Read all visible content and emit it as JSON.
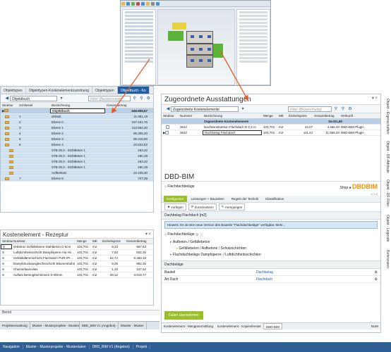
{
  "left_panel": {
    "tabs": [
      "Objekttypen",
      "Objekttypen-Kostenelementzuordnung",
      "Objekttypen",
      "Objektbuch - Ko"
    ],
    "combo": "Objektbuch",
    "filter_placeholder": "Filter (Bezeichnung)",
    "columns": [
      "Struktur",
      "Schlüssel",
      "Bezeichnung",
      "Gesamtbetrag"
    ],
    "rows": [
      {
        "key": "",
        "name": "Objektbuch",
        "amount": "546.855,67"
      },
      {
        "key": "1",
        "name": "default",
        "amount": "11.081,19"
      },
      {
        "key": "2",
        "name": "Ebene 0",
        "amount": "187.161,76"
      },
      {
        "key": "3",
        "name": "Ebene 1",
        "amount": "112.552,20"
      },
      {
        "key": "4",
        "name": "Ebene 2",
        "amount": "95.306,20"
      },
      {
        "key": "5",
        "name": "Ebene 3",
        "amount": "95.218,60"
      },
      {
        "key": "6",
        "name": "Ebene 4",
        "amount": "22.632,52"
      },
      {
        "key": "",
        "name": "STB 30.0 - Sichtbeton 1",
        "amount": "183,42"
      },
      {
        "key": "",
        "name": "STB 30.0 - Sichtbeton 1",
        "amount": "180,19"
      },
      {
        "key": "",
        "name": "STB 30.0 - Sichtbeton 1",
        "amount": "183,42"
      },
      {
        "key": "",
        "name": "STB 30.0 - Sichtbeton 1",
        "amount": "180,19"
      },
      {
        "key": "",
        "name": "Aufbetsatz",
        "amount": "22.105,30"
      },
      {
        "key": "7",
        "name": "Ebene 5",
        "amount": "727,39"
      }
    ]
  },
  "rezept": {
    "title": "Kostenelement - Rezeptur",
    "columns": [
      "Struktur",
      "Nutztext",
      "Menge",
      "ME",
      "Einheitspreis",
      "Gesamtbetrag"
    ],
    "rows": [
      {
        "s": "S",
        "text": "Ortbeton Gefällebeton Stahlbeton D 5cm",
        "qty": "103,701",
        "unit": "m2",
        "price": "9,33",
        "total": "967,53"
      },
      {
        "s": "S",
        "text": "Luftdichtheitsschicht Dampfsperre Alu-Verbu",
        "qty": "103,701",
        "unit": "m2",
        "price": "7,93",
        "total": "822,35"
      },
      {
        "s": "S",
        "text": "Gefälledämmschicht Flachdach PUR-/PIR-H",
        "qty": "103,701",
        "unit": "m2",
        "price": "52,74",
        "total": "5.469,19"
      },
      {
        "s": "S",
        "text": "Dampfdruckausgleichsschicht Bitumenbahn",
        "qty": "103,701",
        "unit": "m2",
        "price": "9,28",
        "total": "962,35"
      },
      {
        "s": "S",
        "text": "Chemiefaservlies",
        "qty": "103,701",
        "unit": "m2",
        "price": "1,33",
        "total": "137,92"
      },
      {
        "s": "S",
        "text": "Auflast Betongittersteinen D 80mm",
        "qty": "103,701",
        "unit": "m2",
        "price": "29,12",
        "total": "3.019,77"
      }
    ]
  },
  "status": {
    "text": "Bereit"
  },
  "bottom_tabs": [
    "Projektverwaltung",
    "Muster - Musterprojekte - Mustereinteilung",
    "DBD_BIM V1 (Angebot) - Dar",
    "\\Muster - Muster"
  ],
  "navbar": [
    "Navigation",
    "Muster - Musterprojekte - Musterdaten",
    "DBD_BIM V1 (Angebot)",
    "Projekt"
  ],
  "right": {
    "title": "Zugeordnete Ausstattungen",
    "combo": "Zugeordnete Kostenelemente",
    "filter_placeholder": "Filter (Bezeichnung)",
    "columns": [
      "Struktur",
      "Nummer",
      "Bezeichnung",
      "Menge",
      "ME",
      "Einheitspreis",
      "Gesamtbetrag",
      "Herkunft"
    ],
    "group_row": {
      "name": "Zugeordnete Kostenelemente",
      "total": "16.021,80"
    },
    "rows": [
      {
        "nr": "3612",
        "name": "Dachkonstruktion Flachdach D 0,2 m",
        "qty": "103,701",
        "unit": "m2",
        "price": "43,07",
        "total": "4.466,40",
        "origin": "DBD-BIM Plugin"
      },
      {
        "nr": "3632",
        "name": "Dachbelag Flachdach",
        "qty": "103,701",
        "unit": "m2",
        "price": "111,43",
        "total": "11.555,40",
        "origin": "DBD-BIM Plugin"
      }
    ],
    "side_tabs": [
      "Objekt - Eigenschaften",
      "Objekt - DF-Attribute",
      "Objekt - DF-Filter",
      "Objekt - Legende",
      "Referenzen"
    ]
  },
  "dbd": {
    "title": "DBD-BIM",
    "subtitle": "Flachdachbeläge",
    "shop_label": "Shop",
    "logo_text": "DBDBIM",
    "version": "V 0.0",
    "menu": [
      "Konfigurator",
      "Leistungen + Bauzeiten",
      "Regeln der Technik",
      "Klassifikation"
    ],
    "actions": [
      "vorlegen",
      "Zurücksetzen",
      "Anregungen"
    ],
    "header": "Dachbelag Flachdach [m2]",
    "info": "Hinweis: Es ist eine neue Version des Bauteils \"Flachdachbeläge\" verfügbar. Mehr...",
    "tree_label": "Flachdachbeläge",
    "tree": [
      "Aufbeton / Gefällebeton",
      "Gefällebeton / Aufbetone / Schutzschichten",
      "Flachdachbeläge Dampfsperre- / Luftdichtheitsschichten"
    ],
    "section": "Dachbeläge",
    "fields": [
      {
        "k": "Bauteil",
        "v": "Dachbelag"
      },
      {
        "k": "Art Dach",
        "v": "Flachdach"
      }
    ],
    "apply_button": "Daten übernehmen",
    "bottom_tabs": [
      "Kostenelement - Mengenermittlung",
      "Kostenelement - Kopienfenster",
      "DBD-BIM"
    ],
    "bottom_status": [
      "NUM"
    ]
  }
}
